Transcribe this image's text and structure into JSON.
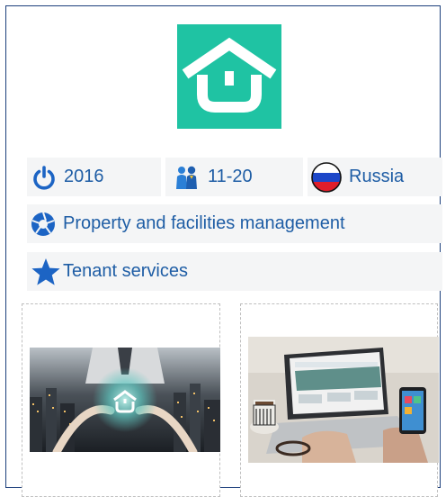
{
  "company": {
    "logo_icon": "house-u-logo-icon",
    "logo_color": "#1fc3a3"
  },
  "facts": {
    "founded_year": "2016",
    "employees": "11-20",
    "country": "Russia",
    "category": "Property and facilities management",
    "subcategory": "Tenant services"
  },
  "icons": {
    "year": "power-icon",
    "employees": "people-icon",
    "country": "russia-flag-icon",
    "category": "aperture-icon",
    "subcategory": "star-icon"
  },
  "colors": {
    "text": "#1e5da5",
    "pill_bg": "#f4f5f6",
    "frame": "#1c3f7c"
  },
  "media": [
    {
      "subject": "businessman holding glowing house logo over night city"
    },
    {
      "subject": "laptop and smartphone showing website on desk"
    }
  ]
}
